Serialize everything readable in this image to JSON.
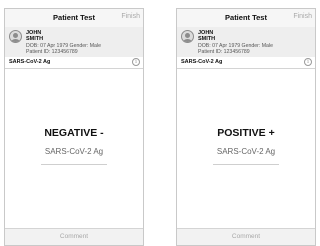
{
  "screens": [
    {
      "nav": {
        "title": "Patient Test",
        "finish_label": "Finish"
      },
      "patient": {
        "first_name": "JOHN",
        "last_name": "SMITH",
        "dob_line": "DOB: 07 Apr 1979   Gender: Male",
        "id_line": "Patient ID: 123456789"
      },
      "test": {
        "name": "SARS-CoV-2 Ag"
      },
      "result": {
        "value": "NEGATIVE -",
        "test_name": "SARS-CoV-2 Ag"
      },
      "footer": {
        "comment_label": "Comment"
      }
    },
    {
      "nav": {
        "title": "Patient Test",
        "finish_label": "Finish"
      },
      "patient": {
        "first_name": "JOHN",
        "last_name": "SMITH",
        "dob_line": "DOB: 07 Apr 1979   Gender: Male",
        "id_line": "Patient ID: 123456789"
      },
      "test": {
        "name": "SARS-CoV-2 Ag"
      },
      "result": {
        "value": "POSITIVE +",
        "test_name": "SARS-CoV-2 Ag"
      },
      "footer": {
        "comment_label": "Comment"
      }
    }
  ],
  "icons": {
    "avatar": "person-avatar-icon",
    "info": "info-icon"
  },
  "colors": {
    "nav_background": "#f6f6f6",
    "patient_background": "#eeeeee",
    "muted_text": "#a8a8a8"
  }
}
